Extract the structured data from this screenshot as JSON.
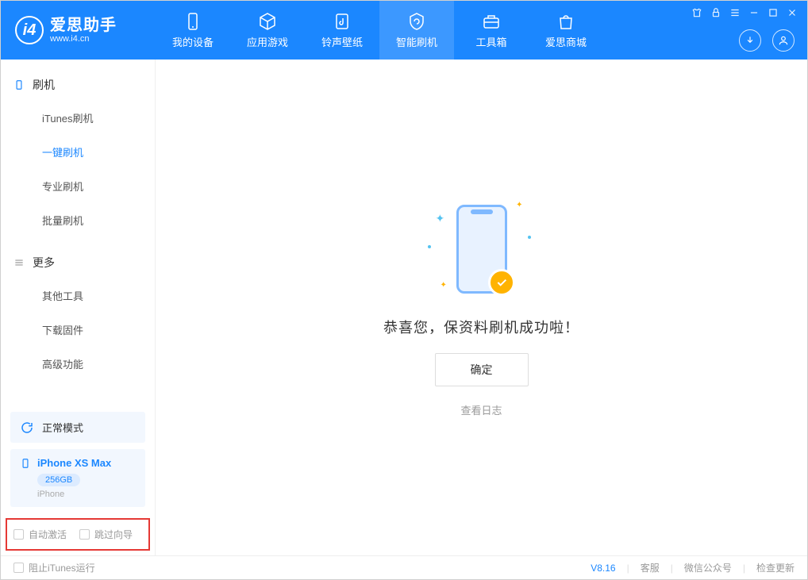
{
  "header": {
    "app_title": "爱思助手",
    "app_url": "www.i4.cn",
    "tabs": [
      "我的设备",
      "应用游戏",
      "铃声壁纸",
      "智能刷机",
      "工具箱",
      "爱思商城"
    ],
    "active_tab_index": 3
  },
  "sidebar": {
    "section1": {
      "title": "刷机",
      "items": [
        "iTunes刷机",
        "一键刷机",
        "专业刷机",
        "批量刷机"
      ],
      "active_index": 1
    },
    "section2": {
      "title": "更多",
      "items": [
        "其他工具",
        "下载固件",
        "高级功能"
      ]
    },
    "mode_label": "正常模式",
    "device": {
      "name": "iPhone XS Max",
      "storage": "256GB",
      "type": "iPhone"
    },
    "checkbox1": "自动激活",
    "checkbox2": "跳过向导"
  },
  "main": {
    "success_message": "恭喜您，保资料刷机成功啦！",
    "ok_button": "确定",
    "view_log": "查看日志"
  },
  "footer": {
    "block_itunes": "阻止iTunes运行",
    "version": "V8.16",
    "links": [
      "客服",
      "微信公众号",
      "检查更新"
    ]
  }
}
